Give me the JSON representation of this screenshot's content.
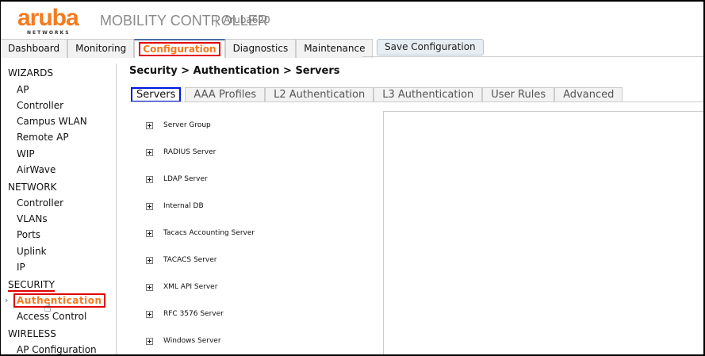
{
  "header": {
    "logo": "aruba",
    "logo_sub": "NETWORKS",
    "product": "MOBILITY CONTROLLER",
    "host": "Aruba620"
  },
  "tabs": [
    "Dashboard",
    "Monitoring",
    "Configuration",
    "Diagnostics",
    "Maintenance"
  ],
  "active_tab": "Configuration",
  "save_label": "Save Configuration",
  "sidebar": {
    "wizards": "WIZARDS",
    "wizard_items": [
      "AP",
      "Controller",
      "Campus WLAN",
      "Remote AP",
      "WIP",
      "AirWave"
    ],
    "network": "NETWORK",
    "network_items": [
      "Controller",
      "VLANs",
      "Ports",
      "Uplink",
      "IP"
    ],
    "security": "SECURITY",
    "security_items": [
      "Authentication",
      "Access Control"
    ],
    "wireless": "WIRELESS",
    "wireless_items": [
      "AP Configuration"
    ]
  },
  "breadcrumb": "Security > Authentication > Servers",
  "subtabs": [
    "Servers",
    "AAA Profiles",
    "L2 Authentication",
    "L3 Authentication",
    "User Rules",
    "Advanced"
  ],
  "servers": [
    "Server Group",
    "RADIUS Server",
    "LDAP Server",
    "Internal DB",
    "Tacacs Accounting Server",
    "TACACS Server",
    "XML API Server",
    "RFC 3576 Server",
    "Windows Server"
  ],
  "colors": {
    "accent": "#f47b20",
    "highlight_red": "#e00000",
    "highlight_blue": "#0018e0"
  }
}
